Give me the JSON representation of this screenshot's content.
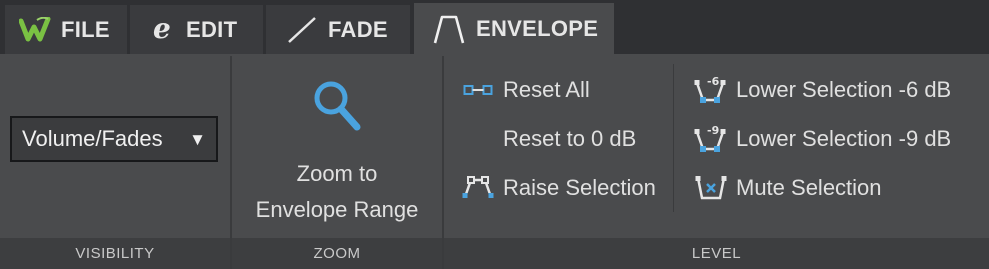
{
  "tabs": [
    {
      "label": "FILE",
      "icon": "wavelab-logo-icon",
      "active": false
    },
    {
      "label": "EDIT",
      "icon": "edit-e-icon",
      "active": false
    },
    {
      "label": "FADE",
      "icon": "fade-line-icon",
      "active": false
    },
    {
      "label": "ENVELOPE",
      "icon": "envelope-shape-icon",
      "active": true
    }
  ],
  "visibility": {
    "dropdown_value": "Volume/Fades",
    "footer": "VISIBILITY"
  },
  "zoom": {
    "button_line1": "Zoom to",
    "button_line2": "Envelope Range",
    "footer": "ZOOM"
  },
  "level": {
    "footer": "LEVEL",
    "reset_all": "Reset All",
    "reset_to_0db": "Reset to 0 dB",
    "raise_selection": "Raise Selection",
    "lower_6db": "Lower Selection -6 dB",
    "lower_9db": "Lower Selection -9 dB",
    "mute_selection": "Mute Selection",
    "icon_minus6_text": "-6",
    "icon_minus9_text": "-9"
  },
  "colors": {
    "accent_blue": "#4aa3df",
    "logo_green": "#7ac143",
    "background": "#4a4b4d",
    "tabbar": "#2f3033"
  }
}
